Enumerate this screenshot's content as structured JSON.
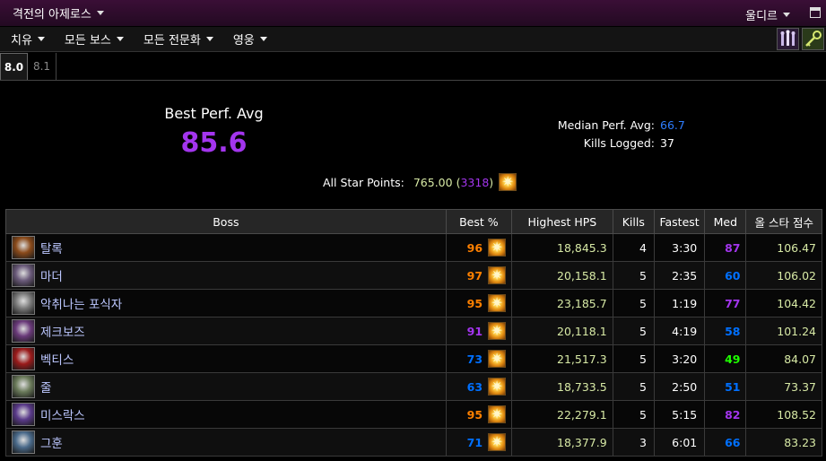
{
  "header": {
    "title": "격전의 아제로스",
    "server": "울디르"
  },
  "menu": {
    "items": [
      "치유",
      "모든 보스",
      "모든 전문화",
      "영웅"
    ]
  },
  "tabs": [
    "8.0",
    "8.1"
  ],
  "summary": {
    "best_perf_label": "Best Perf. Avg",
    "best_perf_value": "85.6",
    "median_label": "Median Perf. Avg:",
    "median_value": "66.7",
    "kills_label": "Kills Logged:",
    "kills_value": "37",
    "star_label": "All Star Points:",
    "star_points": "765.00",
    "star_paren_open": "(",
    "star_count": "3318",
    "star_paren_close": ")"
  },
  "table": {
    "headers": [
      "Boss",
      "Best %",
      "Highest HPS",
      "Kills",
      "Fastest",
      "Med",
      "올 스타 점수"
    ],
    "rows": [
      {
        "boss": "탈록",
        "best": "96",
        "best_color": "#ff8000",
        "hps": "18,845.3",
        "kills": "4",
        "fastest": "3:30",
        "med": "87",
        "med_color": "#a335ee",
        "allstar": "106.47",
        "icon": "boss-taloc-icon",
        "icon_color": "#8a4a1a"
      },
      {
        "boss": "마더",
        "best": "97",
        "best_color": "#ff8000",
        "hps": "20,158.1",
        "kills": "5",
        "fastest": "2:35",
        "med": "60",
        "med_color": "#0070ff",
        "allstar": "106.02",
        "icon": "boss-mother-icon",
        "icon_color": "#6a5a7a"
      },
      {
        "boss": "악취나는 포식자",
        "best": "95",
        "best_color": "#ff8000",
        "hps": "23,185.7",
        "kills": "5",
        "fastest": "1:19",
        "med": "77",
        "med_color": "#a335ee",
        "allstar": "104.42",
        "icon": "boss-devourer-icon",
        "icon_color": "#7a7a7a"
      },
      {
        "boss": "제크보즈",
        "best": "91",
        "best_color": "#a335ee",
        "hps": "20,118.1",
        "kills": "5",
        "fastest": "4:19",
        "med": "58",
        "med_color": "#0070ff",
        "allstar": "101.24",
        "icon": "boss-zekvoz-icon",
        "icon_color": "#6a3a7a"
      },
      {
        "boss": "벡티스",
        "best": "73",
        "best_color": "#0070ff",
        "hps": "21,517.3",
        "kills": "5",
        "fastest": "3:20",
        "med": "49",
        "med_color": "#1eff00",
        "allstar": "84.07",
        "icon": "boss-vectis-icon",
        "icon_color": "#9a1a1a"
      },
      {
        "boss": "줄",
        "best": "63",
        "best_color": "#0070ff",
        "hps": "18,733.5",
        "kills": "5",
        "fastest": "2:50",
        "med": "51",
        "med_color": "#0070ff",
        "allstar": "73.37",
        "icon": "boss-zul-icon",
        "icon_color": "#6a7a5a"
      },
      {
        "boss": "미스락스",
        "best": "95",
        "best_color": "#ff8000",
        "hps": "22,279.1",
        "kills": "5",
        "fastest": "5:15",
        "med": "82",
        "med_color": "#a335ee",
        "allstar": "108.52",
        "icon": "boss-mythrax-icon",
        "icon_color": "#5a3a8a"
      },
      {
        "boss": "그훈",
        "best": "71",
        "best_color": "#0070ff",
        "hps": "18,377.9",
        "kills": "3",
        "fastest": "6:01",
        "med": "66",
        "med_color": "#0070ff",
        "allstar": "83.23",
        "icon": "boss-ghuun-icon",
        "icon_color": "#4a6a8a"
      }
    ]
  },
  "colors": {
    "accent_purple": "#a335ee",
    "median_blue": "#2e7dff",
    "hps_green": "#d7e9a5"
  },
  "icons": {
    "toolbar_left": "raid-group-icon",
    "toolbar_right": "key-icon",
    "star": "star-icon"
  }
}
